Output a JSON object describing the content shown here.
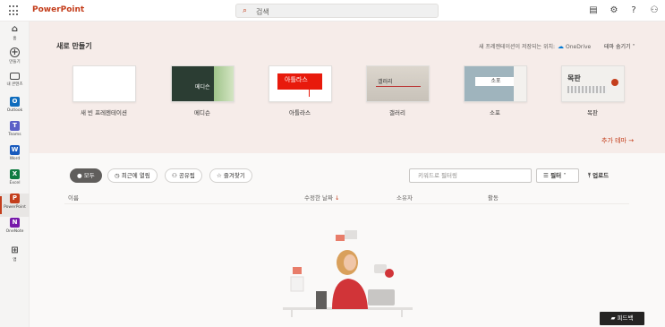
{
  "app": {
    "name": "PowerPoint"
  },
  "search": {
    "placeholder": "검색"
  },
  "topbar_icons": [
    "feedback-icon",
    "settings-icon",
    "help-icon",
    "account-icon"
  ],
  "rail": [
    {
      "label": "홈",
      "icon": "home-icon"
    },
    {
      "label": "만들기",
      "icon": "create-icon"
    },
    {
      "label": "내 콘텐츠",
      "icon": "folder-icon"
    },
    {
      "label": "Outlook",
      "icon": "outlook-icon",
      "color": "#0f6cbd"
    },
    {
      "label": "Teams",
      "icon": "teams-icon",
      "color": "#5b5fc7"
    },
    {
      "label": "Word",
      "icon": "word-icon",
      "color": "#185abd"
    },
    {
      "label": "Excel",
      "icon": "excel-icon",
      "color": "#107c41"
    },
    {
      "label": "PowerPoint",
      "icon": "powerpoint-icon",
      "color": "#c43e1c"
    },
    {
      "label": "OneNote",
      "icon": "onenote-icon",
      "color": "#7719aa"
    },
    {
      "label": "앱",
      "icon": "apps-icon"
    }
  ],
  "new_section": {
    "title": "새로 만들기",
    "save_location_label": "새 프레젠테이션이 저장되는 위치:",
    "save_location": "OneDrive",
    "hide_themes": "테마 숨기기",
    "more_themes": "추가 테마",
    "templates": [
      {
        "label": "새 빈 프레젠테이션",
        "thumb_text": ""
      },
      {
        "label": "메디슨",
        "thumb_text": "메디슨"
      },
      {
        "label": "아틀라스",
        "thumb_text": "아틀라스"
      },
      {
        "label": "갤러리",
        "thumb_text": "갤러리"
      },
      {
        "label": "소포",
        "thumb_text": "소포"
      },
      {
        "label": "목판",
        "thumb_text": "목판"
      }
    ]
  },
  "filters": {
    "tabs": [
      "모두",
      "최근에 열림",
      "공유됨",
      "즐겨찾기"
    ],
    "keyword_placeholder": "키워드로 필터링",
    "filter_label": "필터",
    "upload_label": "업로드"
  },
  "columns": [
    "이름",
    "수정한 날짜",
    "소유자",
    "활동"
  ],
  "feedback_label": "피드백",
  "colors": {
    "accent": "#c43e1c",
    "panel_bg": "#f6ece9"
  }
}
